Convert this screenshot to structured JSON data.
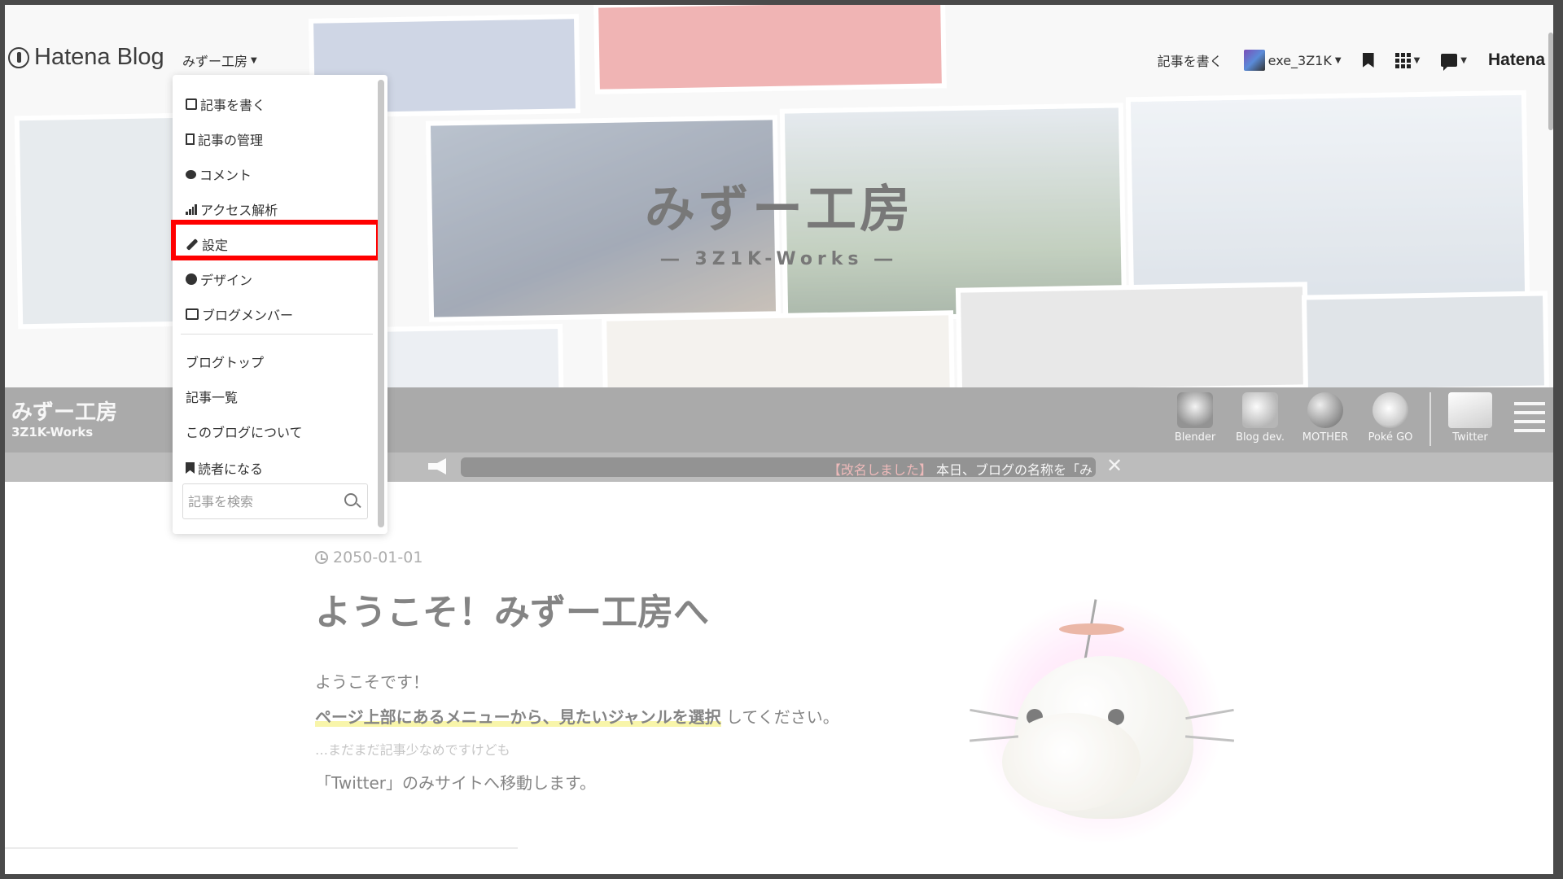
{
  "topbar": {
    "logo_text": "Hatena Blog",
    "blog_switch_label": "みずー工房",
    "write_label": "記事を書く",
    "user_name": "exe_3Z1K",
    "hatena_label": "Hatena"
  },
  "header": {
    "title": "みずー工房",
    "subtitle": "― 3Z1K-Works ―"
  },
  "band": {
    "title": "みずー工房",
    "subtitle": "3Z1K-Works",
    "quick_links": [
      {
        "label": "Blender",
        "icon": "blender-icon"
      },
      {
        "label": "Blog dev.",
        "icon": "blog-dev-icon"
      },
      {
        "label": "MOTHER",
        "icon": "mother-icon"
      },
      {
        "label": "Poké GO",
        "icon": "poke-go-icon"
      },
      {
        "label": "Twitter",
        "icon": "twitter-icon"
      }
    ]
  },
  "announcement": {
    "tag": "【改名しました】",
    "text": "本日、ブログの名称を「み"
  },
  "dropdown": {
    "items": [
      {
        "label": "記事を書く",
        "icon": "edit-icon"
      },
      {
        "label": "記事の管理",
        "icon": "document-icon"
      },
      {
        "label": "コメント",
        "icon": "comment-icon"
      },
      {
        "label": "アクセス解析",
        "icon": "bar-chart-icon"
      },
      {
        "label": "設定",
        "icon": "wrench-icon"
      },
      {
        "label": "デザイン",
        "icon": "palette-icon"
      },
      {
        "label": "ブログメンバー",
        "icon": "members-icon"
      }
    ],
    "links": [
      {
        "label": "ブログトップ"
      },
      {
        "label": "記事一覧"
      },
      {
        "label": "このブログについて"
      },
      {
        "label": "読者になる",
        "icon": "bookmark-icon"
      }
    ],
    "search_placeholder": "記事を検索"
  },
  "article": {
    "date": "2050-01-01",
    "title": "ようこそ！みずー工房へ",
    "p1": "ようこそです！",
    "p2_marked": "ページ上部にあるメニューから、見たいジャンルを選択",
    "p2_rest": "してください。",
    "p3": "…まだまだ記事少なめですけども",
    "p4": "「Twitter」のみサイトへ移動します。"
  },
  "colors": {
    "highlight": "#ff0000",
    "band": "#8a8a8a",
    "marker": "#f6f28a"
  }
}
